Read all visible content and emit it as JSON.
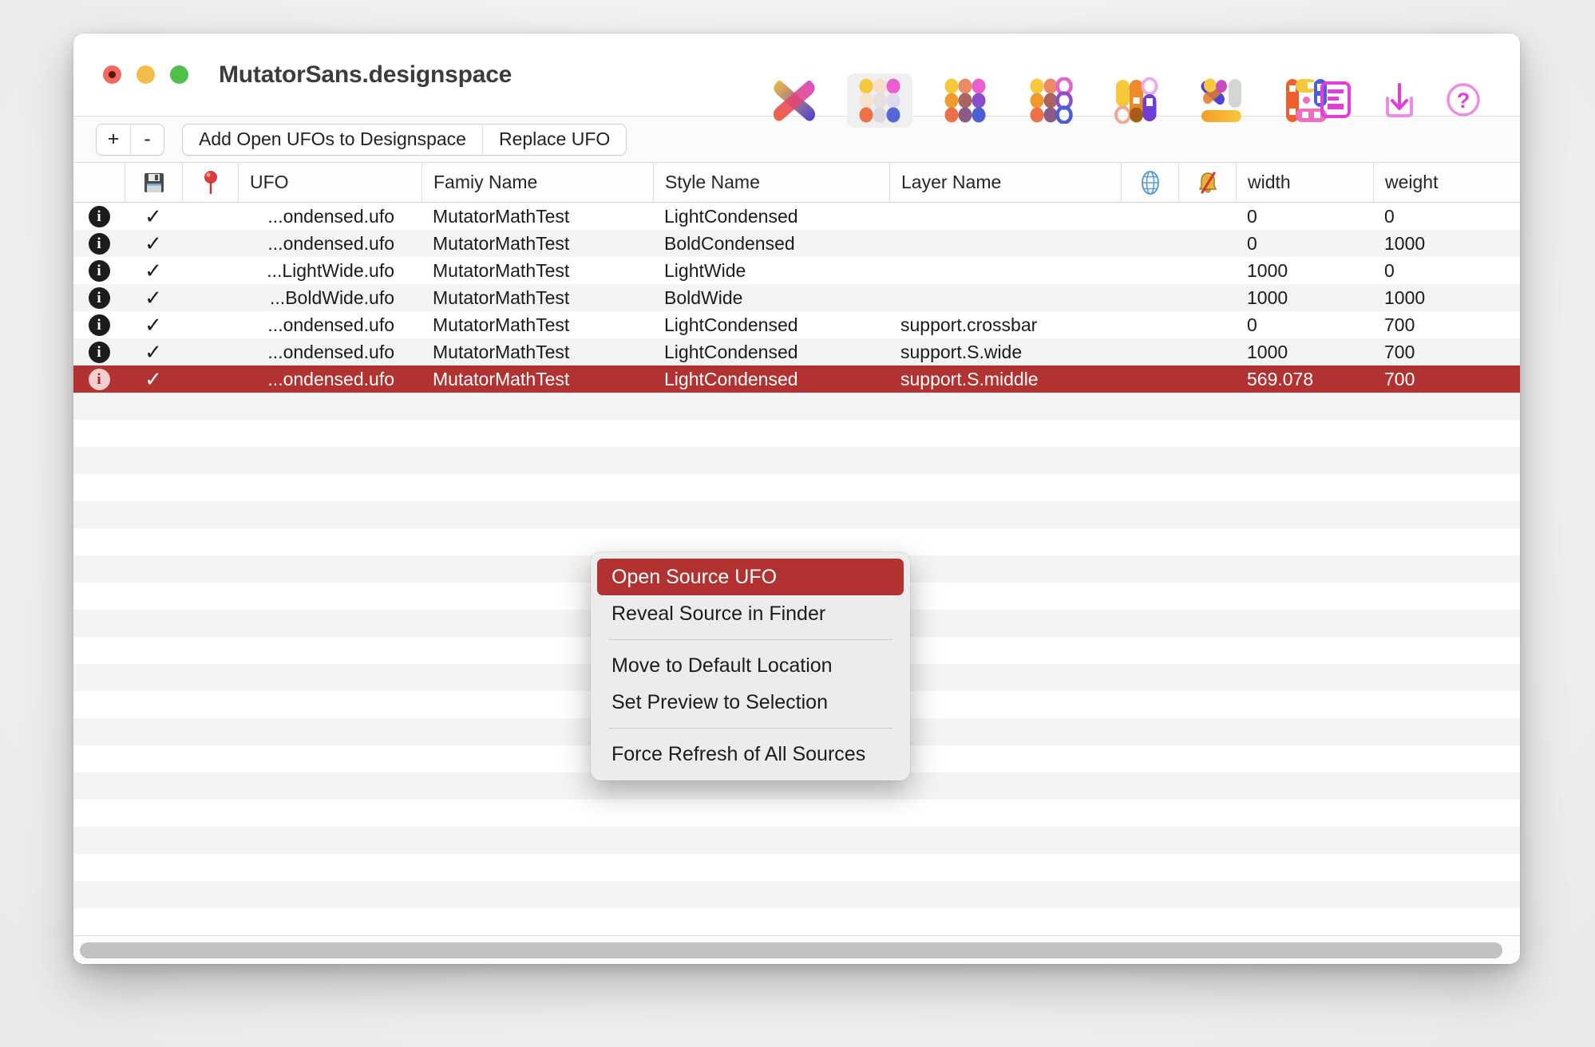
{
  "window": {
    "title": "MutatorSans.designspace",
    "traffic_lights": [
      "close",
      "minimize",
      "maximize"
    ]
  },
  "toolbar": {
    "icons": [
      {
        "name": "mutator-x-icon",
        "label": "X",
        "selected": false
      },
      {
        "name": "designspace-grid-icon",
        "label": "Designspace",
        "selected": true
      },
      {
        "name": "sources-grid-icon",
        "label": "Sources",
        "selected": false
      },
      {
        "name": "instances-grid-icon",
        "label": "Instances",
        "selected": false
      },
      {
        "name": "rules-columns-icon",
        "label": "Rules",
        "selected": false
      },
      {
        "name": "preview-mix-icon",
        "label": "Preview",
        "selected": false
      },
      {
        "name": "problems-blocks-icon",
        "label": "Problems",
        "selected": false
      }
    ],
    "right_icons": [
      {
        "name": "report-document-icon",
        "label": "Report"
      },
      {
        "name": "import-download-icon",
        "label": "Import"
      },
      {
        "name": "help-question-icon",
        "label": "Help"
      }
    ]
  },
  "actionbar": {
    "plus_label": "+",
    "minus_label": "-",
    "add_open_ufos_label": "Add Open UFOs to Designspace",
    "replace_ufo_label": "Replace UFO"
  },
  "table": {
    "columns": [
      {
        "key": "info",
        "label": "",
        "name": "info-column"
      },
      {
        "key": "save",
        "label": "",
        "name": "save-column",
        "icon": "floppy-disk-icon"
      },
      {
        "key": "pin",
        "label": "",
        "name": "pin-column",
        "icon": "pin-icon"
      },
      {
        "key": "ufo",
        "label": "UFO",
        "name": "ufo-column"
      },
      {
        "key": "family",
        "label": "Famiy Name",
        "name": "family-name-column"
      },
      {
        "key": "style",
        "label": "Style Name",
        "name": "style-name-column"
      },
      {
        "key": "layer",
        "label": "Layer Name",
        "name": "layer-name-column"
      },
      {
        "key": "globe",
        "label": "",
        "name": "globe-column",
        "icon": "globe-icon"
      },
      {
        "key": "bell",
        "label": "",
        "name": "muted-column",
        "icon": "bell-slash-icon"
      },
      {
        "key": "width",
        "label": "width",
        "name": "width-column"
      },
      {
        "key": "weight",
        "label": "weight",
        "name": "weight-column"
      }
    ],
    "rows": [
      {
        "check": "✓",
        "ufo": "...ondensed.ufo",
        "family": "MutatorMathTest",
        "style": "LightCondensed",
        "layer": "",
        "width": "0",
        "weight": "0",
        "selected": false
      },
      {
        "check": "✓",
        "ufo": "...ondensed.ufo",
        "family": "MutatorMathTest",
        "style": "BoldCondensed",
        "layer": "",
        "width": "0",
        "weight": "1000",
        "selected": false
      },
      {
        "check": "✓",
        "ufo": "...LightWide.ufo",
        "family": "MutatorMathTest",
        "style": "LightWide",
        "layer": "",
        "width": "1000",
        "weight": "0",
        "selected": false
      },
      {
        "check": "✓",
        "ufo": "...BoldWide.ufo",
        "family": "MutatorMathTest",
        "style": "BoldWide",
        "layer": "",
        "width": "1000",
        "weight": "1000",
        "selected": false
      },
      {
        "check": "✓",
        "ufo": "...ondensed.ufo",
        "family": "MutatorMathTest",
        "style": "LightCondensed",
        "layer": "support.crossbar",
        "width": "0",
        "weight": "700",
        "selected": false
      },
      {
        "check": "✓",
        "ufo": "...ondensed.ufo",
        "family": "MutatorMathTest",
        "style": "LightCondensed",
        "layer": "support.S.wide",
        "width": "1000",
        "weight": "700",
        "selected": false
      },
      {
        "check": "✓",
        "ufo": "...ondensed.ufo",
        "family": "MutatorMathTest",
        "style": "LightCondensed",
        "layer": "support.S.middle",
        "width": "569.078",
        "weight": "700",
        "selected": true
      }
    ],
    "empty_row_count": 22,
    "info_badge_glyph": "i"
  },
  "context_menu": {
    "items": [
      {
        "label": "Open Source UFO",
        "highlight": true,
        "separator_after": false
      },
      {
        "label": "Reveal Source in Finder",
        "highlight": false,
        "separator_after": true
      },
      {
        "label": "Move to Default Location",
        "highlight": false,
        "separator_after": false
      },
      {
        "label": "Set Preview to Selection",
        "highlight": false,
        "separator_after": true
      },
      {
        "label": "Force Refresh of All Sources",
        "highlight": false,
        "separator_after": false
      }
    ]
  },
  "colors": {
    "selection_red": "#b13230",
    "accent_magenta": "#e44ce0",
    "stripe": "#f4f4f4",
    "window_bg": "#ffffff"
  }
}
